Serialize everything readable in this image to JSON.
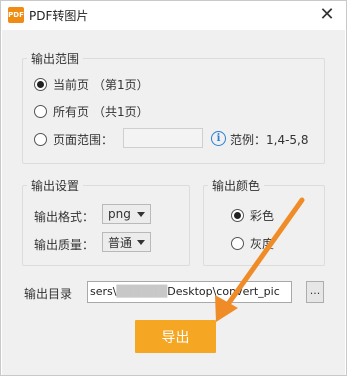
{
  "window": {
    "app_icon_text": "PDF",
    "title": "PDF转图片",
    "close_label": "✕"
  },
  "output_range": {
    "legend": "输出范围",
    "current_page_label": "当前页",
    "current_page_count": "（第1页）",
    "all_pages_label": "所有页",
    "all_pages_count": "（共1页）",
    "page_range_label": "页面范围：",
    "page_range_value": "",
    "info_icon": "i",
    "example_text": "范例：1,4-5,8",
    "selected": "current_page"
  },
  "output_settings": {
    "legend": "输出设置",
    "format_label": "输出格式：",
    "format_value": "png",
    "quality_label": "输出质量：",
    "quality_value": "普通"
  },
  "output_color": {
    "legend": "输出颜色",
    "color_label": "彩色",
    "gray_label": "灰度",
    "selected": "color"
  },
  "output_dir": {
    "label": "输出目录",
    "path_prefix": "sers\\",
    "path_masked": "██████",
    "path_suffix": "Desktop\\convert_pic",
    "browse_label": "..."
  },
  "export_button_label": "导出",
  "colors": {
    "accent_orange": "#f5a623",
    "arrow_orange": "#f08c28",
    "info_blue": "#2a7fd4"
  }
}
